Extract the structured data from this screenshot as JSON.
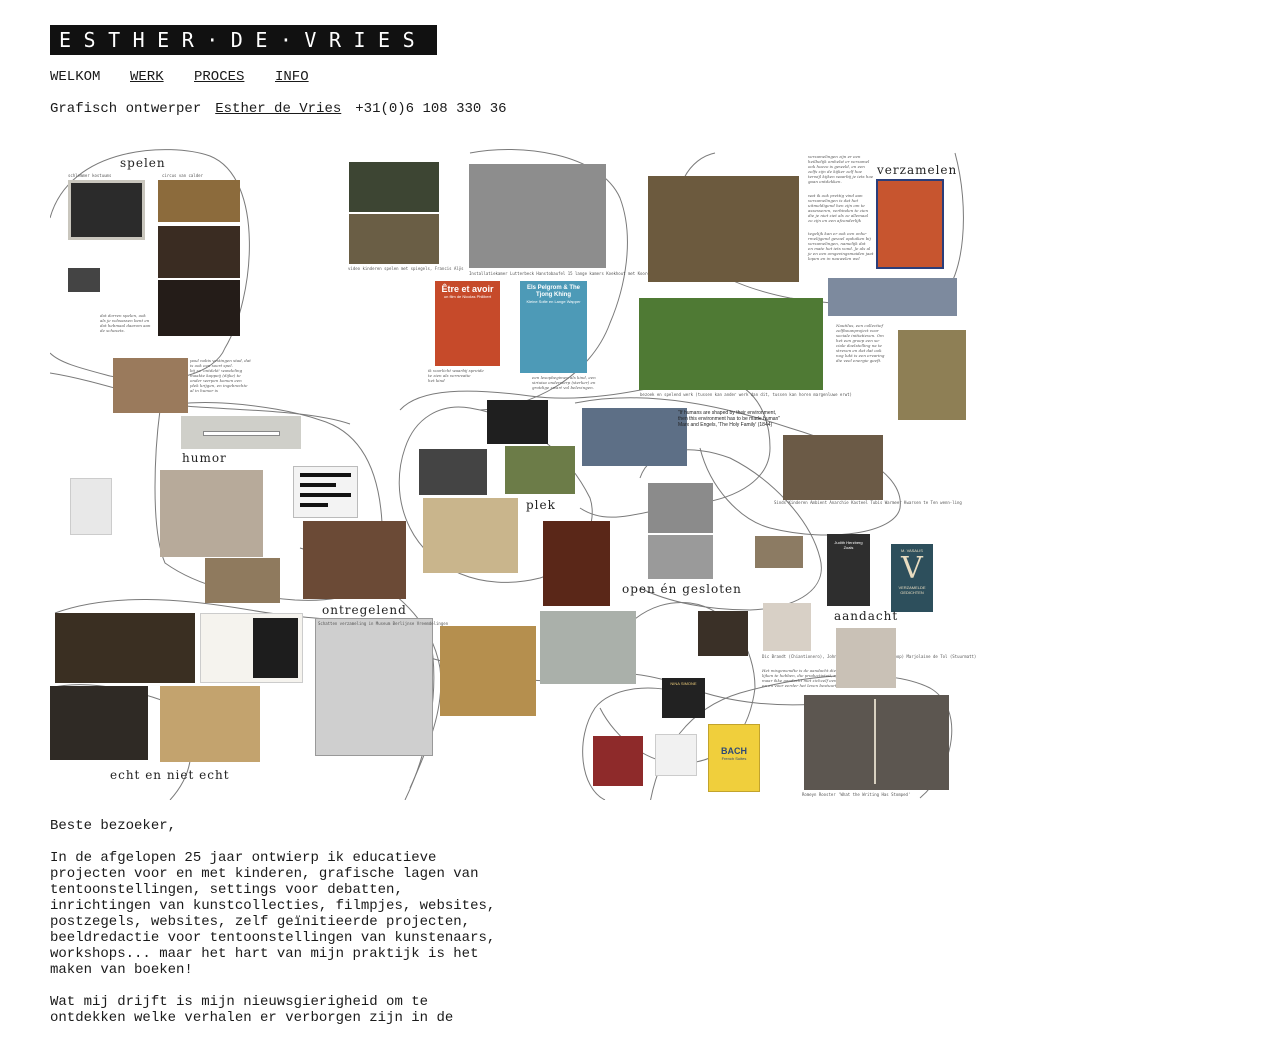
{
  "site": {
    "logo_text": "ESTHER·DE·VRIES"
  },
  "nav": {
    "items": [
      {
        "label": "WELKOM"
      },
      {
        "label": "WERK"
      },
      {
        "label": "PROCES"
      },
      {
        "label": "INFO"
      }
    ]
  },
  "contact": {
    "profession": "Grafisch ontwerper",
    "name_link": "Esther de Vries",
    "phone": "+31(0)6 108 330 36"
  },
  "collage": {
    "labels": {
      "spelen": "spelen",
      "verzamelen": "verzamelen",
      "humor": "humor",
      "plek": "plek",
      "open_en_gesloten": "open én gesloten",
      "ontregelend": "ontregelend",
      "aandacht": "aandacht",
      "echt_en_niet_echt": "echt en niet echt"
    },
    "books": {
      "etre_title": "Être et avoir",
      "etre_sub": "un film de Nicolas Philibert",
      "els_title": "Els Pelgrom & The Tjong Khing",
      "els_sub": "Kleine Sofie en Lange Wapper",
      "v_author": "M. VASALIS",
      "v_letter": "V",
      "v_sub": "VERZAMELDE GEDICHTEN",
      "bach_title": "BACH",
      "bach_sub": "French Suites",
      "nina_title": "NINA SIMONE",
      "diary_author": "Judith Herzberg",
      "diary_title": "Zoals"
    },
    "quote": {
      "line1": "\"If humans are shaped by their environment,",
      "line2": "then this environment has to be made human\"",
      "line3": "Marx and Engels, 'The Holy Family' (1844)"
    },
    "captions": {
      "schlemmer": "schlemmer kostuums",
      "circus": "circus van calder",
      "video": "video kinderen spelen met spiegels, Francis Alÿs",
      "hambueb": "Installatiekamer Lutterbeck Hanstobaufel 15 lange kamers Koekhout met Kooronaanse Berlaggerijke lijnbotshijn in huse terve hoot van tre",
      "schatten": "Schatten verzameling in Museum Berlijnse Vreemdelingen",
      "dichters": "Dic Brandt (Chiantionero), John Appel (Dichtermanner Bebop) Marjolaine de Tol (Stuurmatt)",
      "romeyn": "Romeyn Rooster 'What the Writing Has Stomped'",
      "speelplek": "Sinds Kinderen Ambient Anarchie Kasteel Tubis Warmeer Kwarsen te Ten wenn-ling",
      "bezoek": "bezoek en spelend werk (tussen kan ander werk dan dit, tussen kan horen margenluwe erwt)"
    },
    "texts": {
      "poems_top": "verzamelingen zijn er een\nheilbelijk omhelst er verzamel\nook hoezo is geweld, en een\nzelfs zijn de kijker zelf hoe\nterwijl kijken waarbij je iets hoe\ngaan ontdekken.",
      "poems_mid": "wat ik ook prettig vind aan\nverzamelingen is dat het\nuitmeldigend hen zijn om te\nassesseren, verbinden te zien\ndie je niet ziet als ze allemaal\nzo zijn en een afzonderlijk",
      "poems_low": "tegelijk kan er ook een onhe-\nrmelijgend gevoel opduiken bij\nverzamelingen, namelijk dat\nen mate het iets vond. Je als al\nje en een omgevingsmaiden jaat\nlopen en in nauwelen wel",
      "nautilus": "Nautilus, een collectief\nzelfbouwproject voor\nsociale initiatieven. Om\nhet een groep een so-\nciale doelstelling na te\nstreven en dat dat ook\nnog lukt is een ervaring\ndie veel energie geeft.",
      "spelen_text": "dat dorren spelen, ook\nals je volwassen bent en\ndat hebmaal daarom aan\nde schesets.",
      "hans": "paul nobis vestingen stad, dat\nis ook een soort spel.\nbij zo 'ontdekt' wandeling\nmaakte kappeij (dijke) te\nonder werpen komen een\nplek krijgen, en ingebrachte\nal in humor is",
      "school": "ik voorlicht waarbij spreide\nte zien als verrevatie\nhet kind",
      "lesson": "een lesopbegimen als kind, een\nsiriuisa onderwerp (sterker) en\ngrotdige zwart vol belevingen.",
      "aandacht_note": "Het misgewendte is de aandacht die dan moeten\nlijken te hebben, die productivteit, spreekt\nmaar ikke aandacht met zichzelf een wilt,\nen en voor eerder het leven bestuurt schegel"
    }
  },
  "intro": {
    "greeting": "Beste bezoeker,",
    "para1": "In de afgelopen 25 jaar ontwierp ik educatieve\nprojecten voor en met kinderen, grafische lagen van\ntentoonstellingen, settings voor debatten,\ninrichtingen van kunstcollecties, filmpjes, websites,\npostzegels, websites, zelf geïnitieerde projecten,\nbeeldredactie voor tentoonstellingen van kunstenaars,\nworkshops...  maar het hart van mijn praktijk is het\nmaken van boeken!",
    "para2": "Wat mij drijft is mijn nieuwsgierigheid om te\nontdekken welke verhalen er verborgen zijn in de"
  },
  "colors": {
    "logo_bg": "#111111",
    "logo_fg": "#ffffff",
    "text": "#1a1a1a",
    "v_cover": "#2d4f5c",
    "bach_cover": "#f0cf3c"
  }
}
